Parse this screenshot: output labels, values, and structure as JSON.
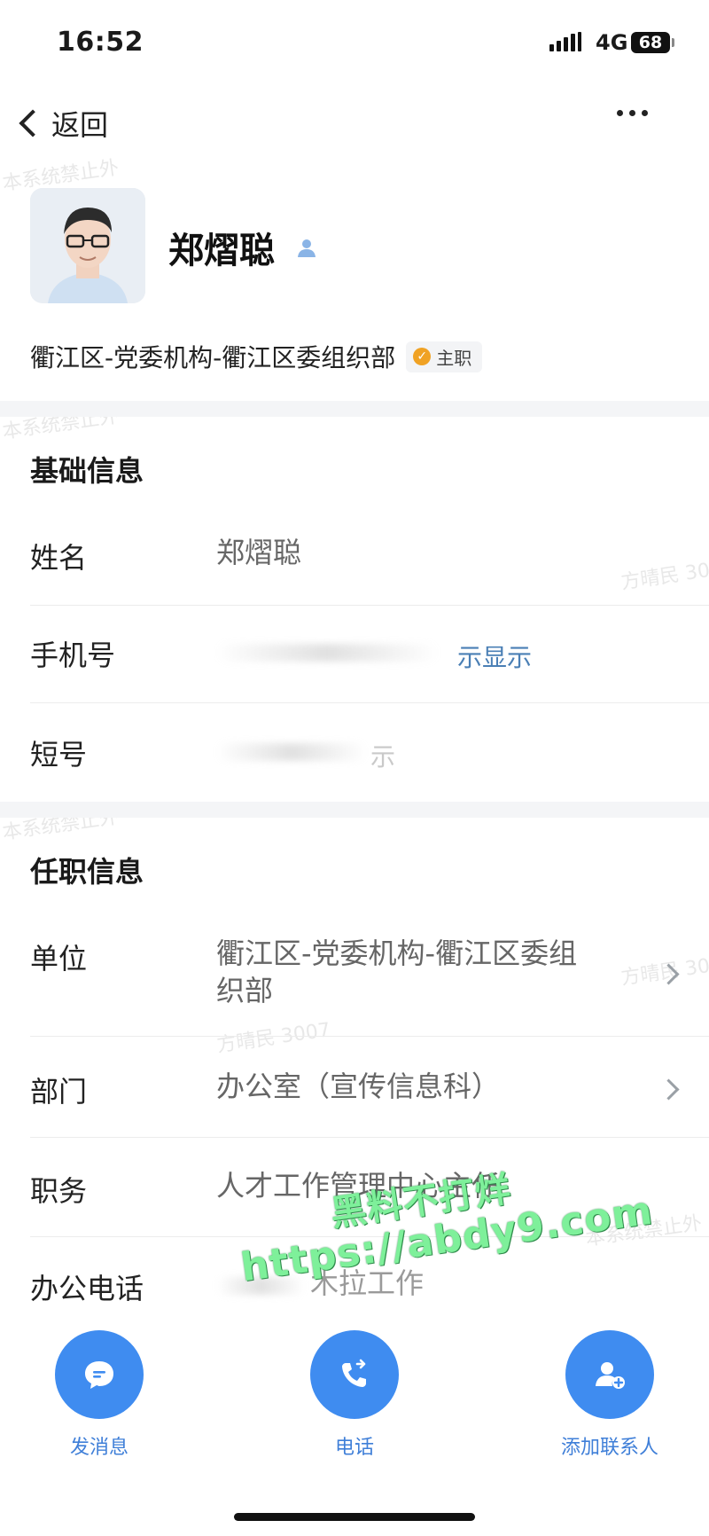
{
  "status_bar": {
    "time": "16:52",
    "network": "4G",
    "battery": "68"
  },
  "nav": {
    "back_label": "返回"
  },
  "profile": {
    "name": "郑熠聪",
    "org_path": "衢江区-党委机构-衢江区委组织部",
    "tag": "主职"
  },
  "basic_info": {
    "title": "基础信息",
    "name_label": "姓名",
    "name_value": "郑熠聪",
    "mobile_label": "手机号",
    "mobile_hint": "示显示",
    "short_label": "短号",
    "short_hint": "示"
  },
  "job_info": {
    "title": "任职信息",
    "unit_label": "单位",
    "unit_value": "衢江区-党委机构-衢江区委组织部",
    "dept_label": "部门",
    "dept_value": "办公室（宣传信息科）",
    "position_label": "职务",
    "position_value": "人才工作管理中心主任",
    "office_phone_label": "办公电话",
    "office_phone_value": "木拉工作"
  },
  "watermark": "本系统禁止外",
  "watermark_name": "方晴民 3007",
  "overlay": {
    "line1": "黑料不打烊",
    "line2": "https://abdy9.com"
  },
  "actions": [
    {
      "label": "发消息",
      "icon": "message-icon"
    },
    {
      "label": "电话",
      "icon": "phone-icon"
    },
    {
      "label": "添加联系人",
      "icon": "add-contact-icon"
    }
  ],
  "colors": {
    "accent": "#3f8cf0",
    "link": "#4a7fb5",
    "tag_badge": "#f0a224"
  }
}
